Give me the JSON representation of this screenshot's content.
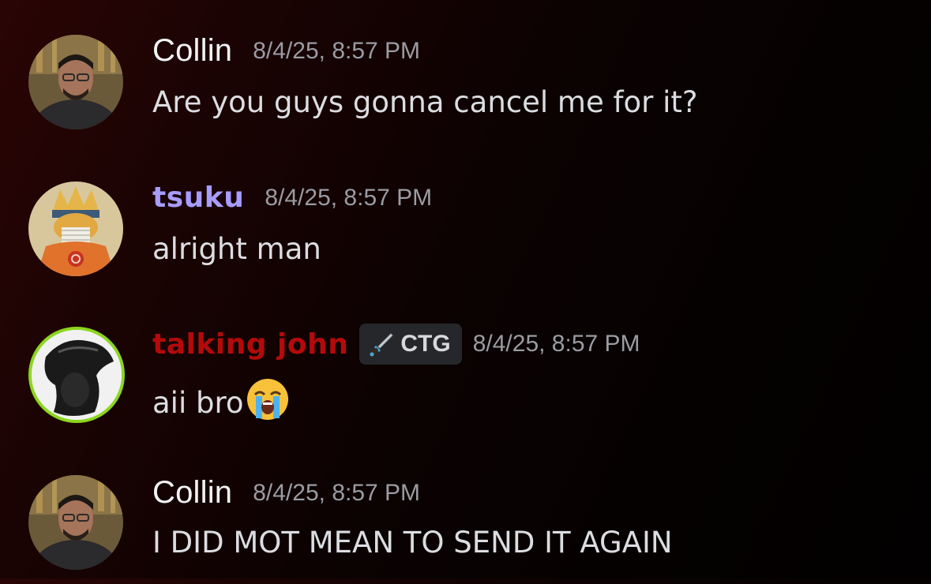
{
  "colors": {
    "collin_name": "#f2f3f5",
    "tsuku_name": "#a79cff",
    "john_name": "#b50a0a",
    "timestamp": "#9a9ca3",
    "message_text": "#dcdde1",
    "tag_bg": "#26272b",
    "avatar_ring": "#8cd61e"
  },
  "messages": [
    {
      "username": "Collin",
      "timestamp": "8/4/25, 8:57 PM",
      "text": "Are you guys gonna cancel me for it?",
      "avatar_icon": "user-photo-avatar"
    },
    {
      "username": "tsuku",
      "timestamp": "8/4/25, 8:57 PM",
      "text": "alright man",
      "avatar_icon": "anime-character-avatar"
    },
    {
      "username": "talking john",
      "timestamp": "8/4/25, 8:57 PM",
      "tag": {
        "icon": "sword-icon",
        "label": "CTG"
      },
      "text": "aii bro",
      "emoji": "loudly-crying-face-emoji",
      "avatar_icon": "dark-figure-avatar"
    },
    {
      "username": "Collin",
      "timestamp": "8/4/25, 8:57 PM",
      "text": "I DID MOT MEAN TO SEND IT AGAIN",
      "avatar_icon": "user-photo-avatar"
    }
  ]
}
